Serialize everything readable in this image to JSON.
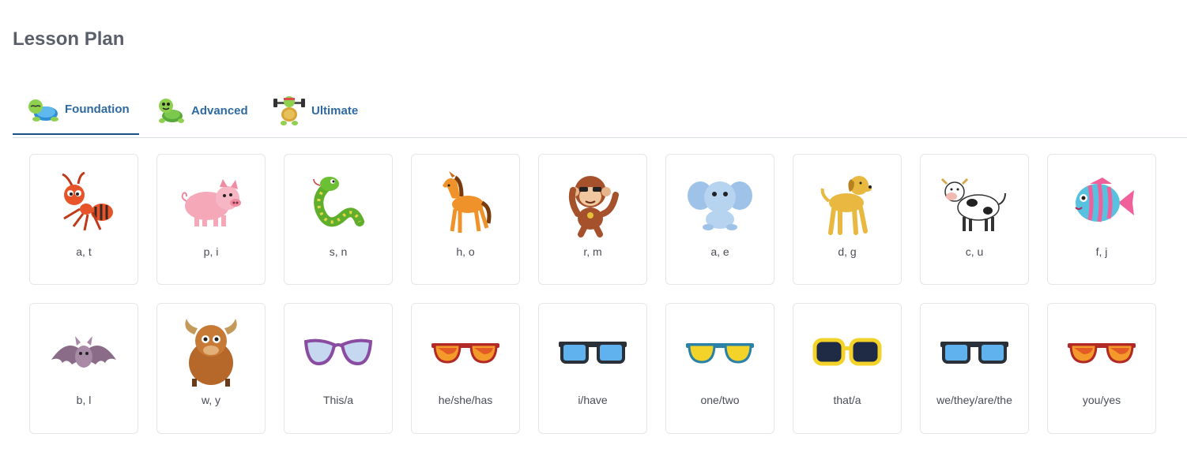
{
  "page": {
    "title": "Lesson Plan"
  },
  "tabs": [
    {
      "label": "Foundation",
      "icon": "turtle-sleeping-icon",
      "active": true
    },
    {
      "label": "Advanced",
      "icon": "turtle-smiling-icon",
      "active": false
    },
    {
      "label": "Ultimate",
      "icon": "turtle-weightlifting-icon",
      "active": false
    }
  ],
  "cards_row1": [
    {
      "label": "a, t",
      "icon": "ant-icon"
    },
    {
      "label": "p, i",
      "icon": "pig-icon"
    },
    {
      "label": "s, n",
      "icon": "snake-icon"
    },
    {
      "label": "h, o",
      "icon": "horse-icon"
    },
    {
      "label": "r, m",
      "icon": "monkey-icon"
    },
    {
      "label": "a, e",
      "icon": "elephant-icon"
    },
    {
      "label": "d, g",
      "icon": "dog-icon"
    },
    {
      "label": "c, u",
      "icon": "cow-icon"
    },
    {
      "label": "f, j",
      "icon": "fish-icon"
    }
  ],
  "cards_row2": [
    {
      "label": "b, l",
      "icon": "bat-icon"
    },
    {
      "label": "w, y",
      "icon": "yak-icon"
    },
    {
      "label": "This/a",
      "icon": "cat-eye-glasses-icon"
    },
    {
      "label": "he/she/has",
      "icon": "red-sunglasses-icon"
    },
    {
      "label": "i/have",
      "icon": "blue-sunglasses-icon"
    },
    {
      "label": "one/two",
      "icon": "yellow-sunglasses-icon"
    },
    {
      "label": "that/a",
      "icon": "yellow-frame-glasses-icon"
    },
    {
      "label": "we/they/are/the",
      "icon": "blue-sunglasses-icon"
    },
    {
      "label": "you/yes",
      "icon": "red-sunglasses-icon"
    }
  ],
  "colors": {
    "title": "#5b5f6a",
    "tab_text": "#2e6aa1",
    "tab_active_border": "#1d4f86",
    "card_border": "#e4e6ea"
  }
}
